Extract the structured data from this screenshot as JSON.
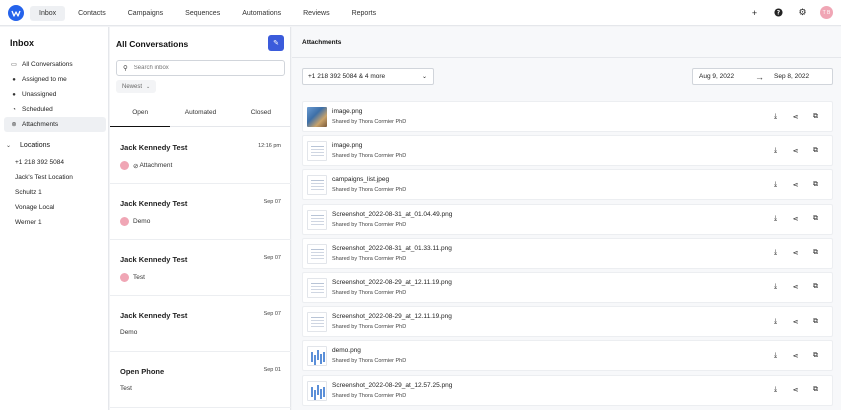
{
  "nav": {
    "tabs": [
      {
        "label": "Inbox",
        "active": true
      },
      {
        "label": "Contacts"
      },
      {
        "label": "Campaigns"
      },
      {
        "label": "Sequences"
      },
      {
        "label": "Automations"
      },
      {
        "label": "Reviews"
      },
      {
        "label": "Reports"
      }
    ],
    "avatar_initials": "T B",
    "icons": [
      "plus-icon",
      "help-icon",
      "gear-icon"
    ]
  },
  "sidebar": {
    "title": "Inbox",
    "items": [
      {
        "label": "All Conversations",
        "icon": "inbox-icon"
      },
      {
        "label": "Assigned to me",
        "icon": "user-icon"
      },
      {
        "label": "Unassigned",
        "icon": "user-outline-icon"
      },
      {
        "label": "Scheduled",
        "icon": "clock-icon"
      },
      {
        "label": "Attachments",
        "icon": "paperclip-icon",
        "active": true
      }
    ],
    "locations_label": "Locations",
    "locations": [
      "+1 218 392 5084",
      "Jack's Test Location",
      "Schultz 1",
      "Vonage Local",
      "Werner 1"
    ]
  },
  "conversations": {
    "title": "All Conversations",
    "search_placeholder": "Search inbox",
    "sort_label": "Newest",
    "tabs": [
      "Open",
      "Automated",
      "Closed"
    ],
    "items": [
      {
        "name": "Jack Kennedy Test",
        "date": "12:16 pm",
        "preview": "Attachment",
        "has_dot": true,
        "has_clip": true
      },
      {
        "name": "Jack Kennedy Test",
        "date": "Sep 07",
        "preview": "Demo",
        "has_dot": true
      },
      {
        "name": "Jack Kennedy Test",
        "date": "Sep 07",
        "preview": "Test",
        "has_dot": true
      },
      {
        "name": "Jack Kennedy Test",
        "date": "Sep 07",
        "preview": "Demo",
        "has_dot": false
      },
      {
        "name": "Open Phone",
        "date": "Sep 01",
        "preview": "Test",
        "has_dot": false
      }
    ]
  },
  "attachments": {
    "title": "Attachments",
    "phone_filter": "+1 218 392 5084 & 4 more",
    "date_from": "Aug 9, 2022",
    "date_to": "Sep 8, 2022",
    "items": [
      {
        "name": "image.png",
        "shared_by": "Shared by Thora Cormier PhD",
        "thumb": "photo"
      },
      {
        "name": "image.png",
        "shared_by": "Shared by Thora Cormier PhD",
        "thumb": "doc"
      },
      {
        "name": "campaigns_list.jpeg",
        "shared_by": "Shared by Thora Cormier PhD",
        "thumb": "doc"
      },
      {
        "name": "Screenshot_2022-08-31_at_01.04.49.png",
        "shared_by": "Shared by Thora Cormier PhD",
        "thumb": "doc"
      },
      {
        "name": "Screenshot_2022-08-31_at_01.33.11.png",
        "shared_by": "Shared by Thora Cormier PhD",
        "thumb": "doc"
      },
      {
        "name": "Screenshot_2022-08-29_at_12.11.19.png",
        "shared_by": "Shared by Thora Cormier PhD",
        "thumb": "doc"
      },
      {
        "name": "Screenshot_2022-08-29_at_12.11.19.png",
        "shared_by": "Shared by Thora Cormier PhD",
        "thumb": "doc"
      },
      {
        "name": "demo.png",
        "shared_by": "Shared by Thora Cormier PhD",
        "thumb": "chart"
      },
      {
        "name": "Screenshot_2022-08-29_at_12.57.25.png",
        "shared_by": "Shared by Thora Cormier PhD",
        "thumb": "chart"
      }
    ],
    "actions": [
      "download-icon",
      "share-icon",
      "open-external-icon"
    ]
  },
  "colors": {
    "accent": "#3b5bdb",
    "avatar": "#f0a6b5",
    "logo": "#2563eb"
  }
}
